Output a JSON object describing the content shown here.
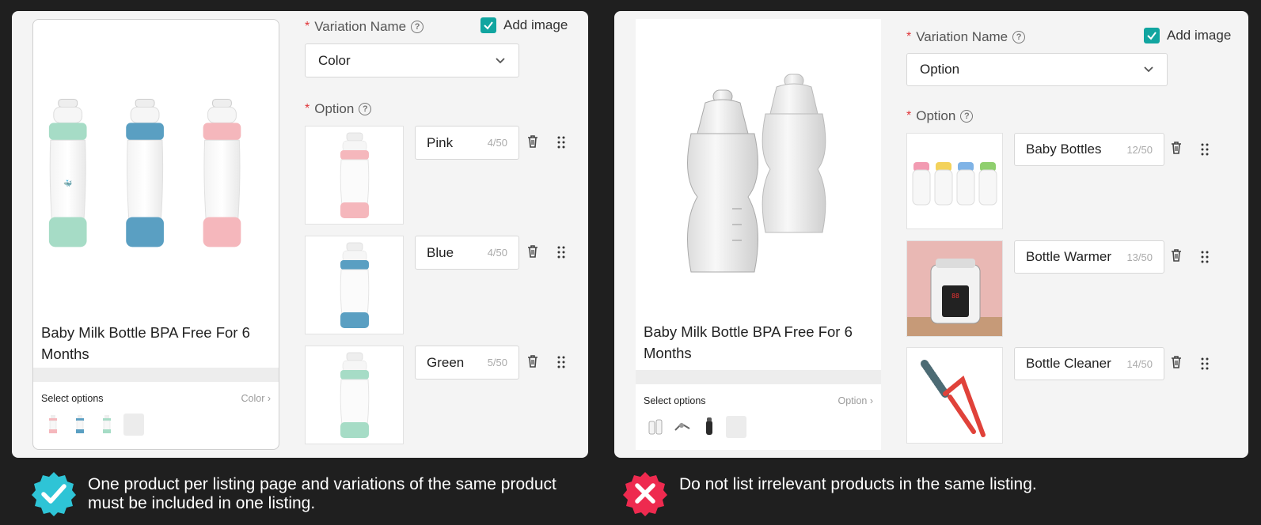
{
  "left": {
    "product_title": "Baby Milk Bottle BPA Free For 6 Months",
    "select_options_label": "Select options",
    "select_options_link": "Color ›",
    "variation_label": "Variation Name",
    "add_image_label": "Add image",
    "variation_value": "Color",
    "option_label": "Option",
    "options": [
      {
        "name": "Pink",
        "counter": "4/50",
        "color": "#f5b7bc"
      },
      {
        "name": "Blue",
        "counter": "4/50",
        "color": "#5a9fc2"
      },
      {
        "name": "Green",
        "counter": "5/50",
        "color": "#a8dcc4"
      }
    ]
  },
  "right": {
    "product_title": "Baby Milk Bottle BPA Free For 6 Months",
    "select_options_label": "Select options",
    "select_options_link": "Option ›",
    "variation_label": "Variation Name",
    "add_image_label": "Add image",
    "variation_value": "Option",
    "option_label": "Option",
    "options": [
      {
        "name": "Baby Bottles",
        "counter": "12/50"
      },
      {
        "name": "Bottle Warmer",
        "counter": "13/50"
      },
      {
        "name": "Bottle Cleaner",
        "counter": "14/50"
      }
    ]
  },
  "captions": {
    "good": "One product per listing page and variations of the same product must be included in one listing.",
    "bad": "Do not list irrelevant products in the same listing."
  },
  "colors": {
    "accent": "#11a5a0",
    "required": "#e0363a",
    "good_badge": "#2ec4d6",
    "bad_badge": "#ee2a4f"
  }
}
